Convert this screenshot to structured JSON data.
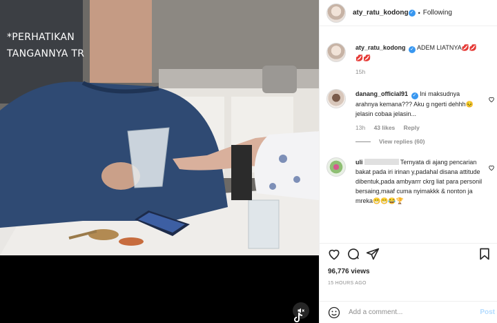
{
  "media": {
    "overlay_text": "*PERHATIKAN\nTANGANNYA TR",
    "mute_icon": "speaker-muted-icon",
    "watermark_icon": "tiktok-logo-icon"
  },
  "header": {
    "username": "aty_ratu_kodong",
    "separator": "•",
    "follow_label": "Following"
  },
  "comments": [
    {
      "username": "aty_ratu_kodong",
      "text": "ADEM LIATNYA💋💋💋💋",
      "time": "15h",
      "is_caption": true
    },
    {
      "username": "danang_official91",
      "text": "Ini maksudnya arahnya kemana??? Aku g ngerti dehhh😣 jelasin cobaa jelasin...",
      "time": "13h",
      "likes": "43 likes",
      "reply_label": "Reply",
      "view_replies": "View replies (60)"
    },
    {
      "username": "uli",
      "text": "Ternyata di ajang pencarian bakat pada iri irinan y,padahal disana attitude dibentuk,pada ambyarrr ckrg liat para personil bersaing,maaf cuma nyimakkk & nonton ja mreka😁😁😂🏆"
    }
  ],
  "actions": {
    "like_icon": "heart-icon",
    "comment_icon": "comment-icon",
    "share_icon": "paper-plane-icon",
    "save_icon": "bookmark-icon"
  },
  "stats": {
    "views": "96,776 views",
    "time_ago": "15 HOURS AGO"
  },
  "add_comment": {
    "placeholder": "Add a comment...",
    "post_label": "Post"
  },
  "colors": {
    "verified": "#3897f0",
    "post_disabled": "#b3dbff",
    "muted_text": "#8e8e8e"
  }
}
